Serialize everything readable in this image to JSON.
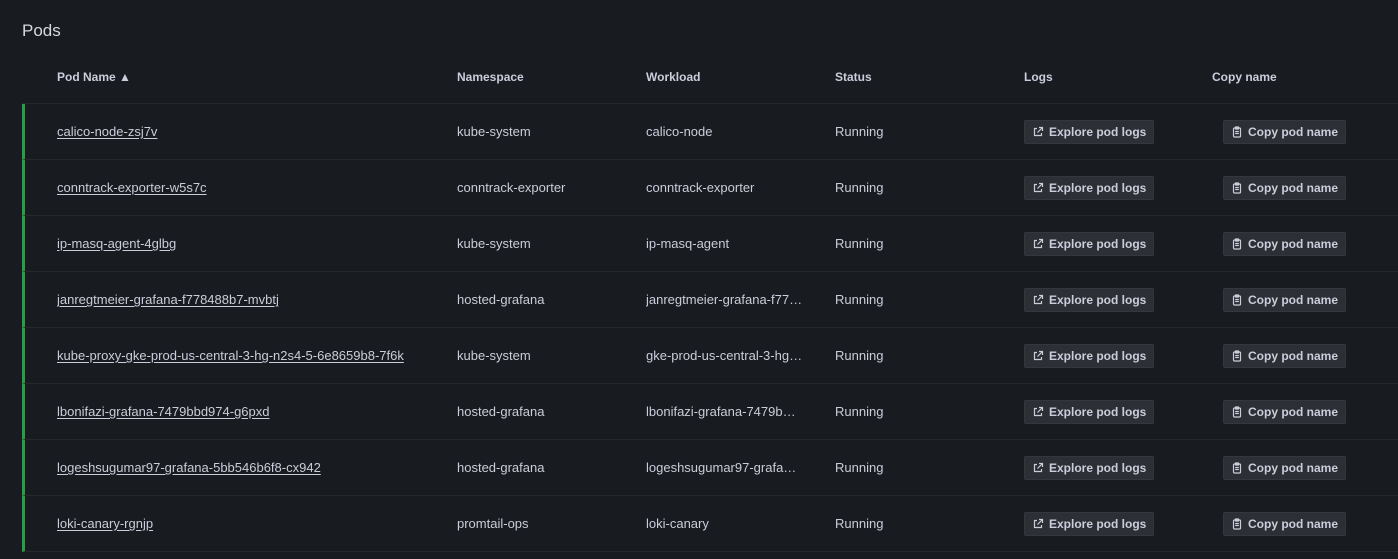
{
  "panel": {
    "title": "Pods"
  },
  "columns": {
    "pod_name": "Pod Name",
    "sort_indicator": "▲",
    "namespace": "Namespace",
    "workload": "Workload",
    "status": "Status",
    "logs": "Logs",
    "copy_name": "Copy name"
  },
  "actions": {
    "explore_logs_label": "Explore pod logs",
    "copy_name_label": "Copy pod name"
  },
  "colors": {
    "running_accent": "#299c46"
  },
  "rows": [
    {
      "pod_name": "calico-node-zsj7v",
      "namespace": "kube-system",
      "workload": "calico-node",
      "status": "Running"
    },
    {
      "pod_name": "conntrack-exporter-w5s7c",
      "namespace": "conntrack-exporter",
      "workload": "conntrack-exporter",
      "status": "Running"
    },
    {
      "pod_name": "ip-masq-agent-4glbg",
      "namespace": "kube-system",
      "workload": "ip-masq-agent",
      "status": "Running"
    },
    {
      "pod_name": "janregtmeier-grafana-f778488b7-mvbtj",
      "namespace": "hosted-grafana",
      "workload": "janregtmeier-grafana-f77…",
      "status": "Running"
    },
    {
      "pod_name": "kube-proxy-gke-prod-us-central-3-hg-n2s4-5-6e8659b8-7f6k",
      "namespace": "kube-system",
      "workload": "gke-prod-us-central-3-hg-…",
      "status": "Running"
    },
    {
      "pod_name": "lbonifazi-grafana-7479bbd974-g6pxd",
      "namespace": "hosted-grafana",
      "workload": "lbonifazi-grafana-7479b…",
      "status": "Running"
    },
    {
      "pod_name": "logeshsugumar97-grafana-5bb546b6f8-cx942",
      "namespace": "hosted-grafana",
      "workload": "logeshsugumar97-grafa…",
      "status": "Running"
    },
    {
      "pod_name": "loki-canary-rgnjp",
      "namespace": "promtail-ops",
      "workload": "loki-canary",
      "status": "Running"
    }
  ]
}
